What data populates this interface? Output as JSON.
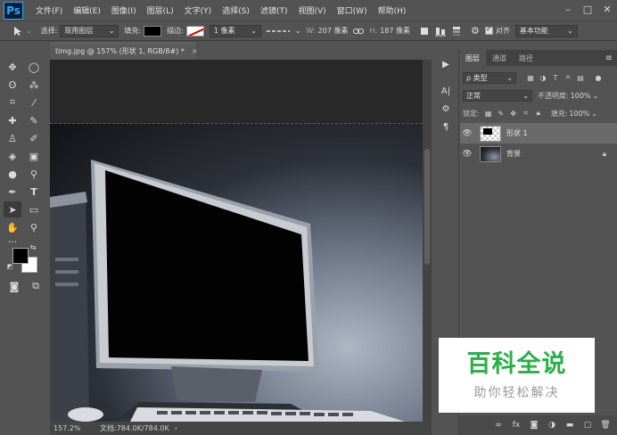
{
  "app": {
    "logo": "Ps"
  },
  "menu": [
    "文件(F)",
    "编辑(E)",
    "图像(I)",
    "图层(L)",
    "文字(Y)",
    "选择(S)",
    "滤镜(T)",
    "视图(V)",
    "窗口(W)",
    "帮助(H)"
  ],
  "window_controls": {
    "minimize": "–",
    "maximize": "□",
    "close": "✕"
  },
  "options": {
    "select_label": "选择:",
    "select_value": "现用图层",
    "fill_label": "填充:",
    "stroke_label": "描边:",
    "stroke_width": "1 像素",
    "w_label": "W:",
    "w_value": "207 像素",
    "h_label": "H:",
    "h_value": "187 像素",
    "align_label": "对齐",
    "workspace_value": "基本功能"
  },
  "document": {
    "tab_title": "timg.jpg @ 157% (形状 1, RGB/8#) *",
    "tab_close": "×"
  },
  "status": {
    "zoom": "157.2%",
    "doc_info": "文档:784.0K/784.0K"
  },
  "panel": {
    "tabs": [
      "图层",
      "通道",
      "路径"
    ],
    "filter_value": "ρ 类型",
    "blend_mode": "正常",
    "opacity_label": "不透明度:",
    "opacity_value": "100%",
    "lock_label": "锁定:",
    "fill_label": "填充:",
    "fill_value": "100%",
    "layers": [
      {
        "name": "形状 1",
        "selected": true
      },
      {
        "name": "背景",
        "selected": false,
        "locked": true
      }
    ]
  },
  "watermark": {
    "title": "百科全说",
    "subtitle": "助你轻松解决"
  },
  "colors": {
    "accent": "#31a8ff",
    "watermark_green": "#2aae4a",
    "ui_bg": "#535353"
  }
}
